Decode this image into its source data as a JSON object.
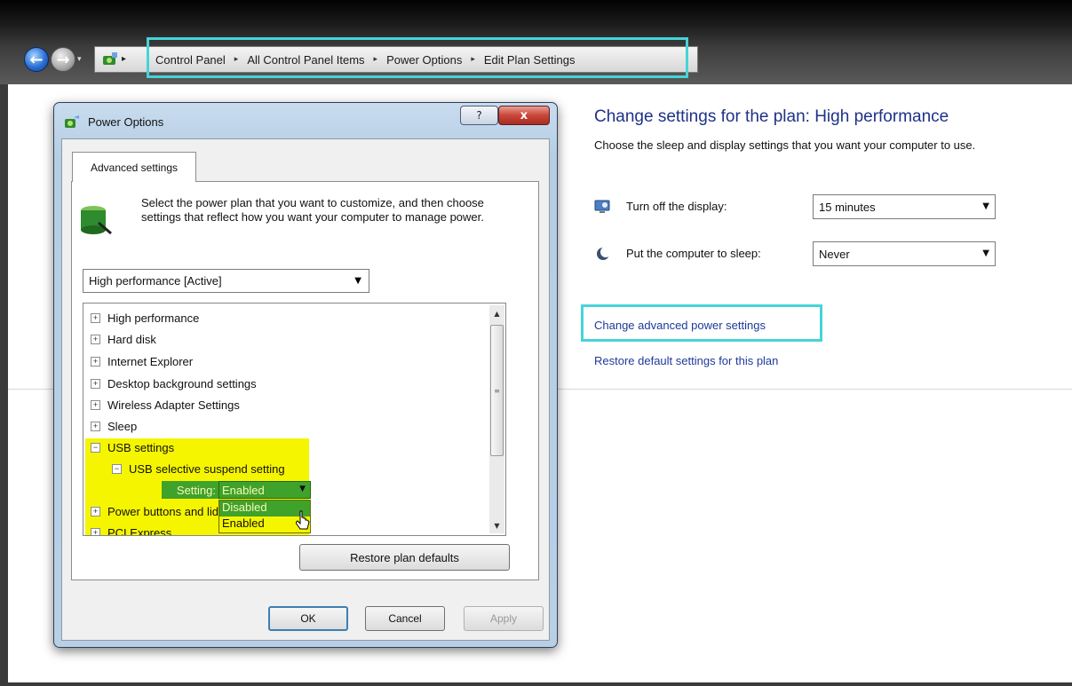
{
  "explorer": {
    "breadcrumbs": [
      "Control Panel",
      "All Control Panel Items",
      "Power Options",
      "Edit Plan Settings"
    ]
  },
  "plan": {
    "title": "Change settings for the plan: High performance",
    "subtitle": "Choose the sleep and display settings that you want your computer to use.",
    "display_label": "Turn off the display:",
    "display_value": "15 minutes",
    "sleep_label": "Put the computer to sleep:",
    "sleep_value": "Never",
    "advanced_link": "Change advanced power settings",
    "restore_link": "Restore default settings for this plan"
  },
  "dialog": {
    "title": "Power Options",
    "help_label": "?",
    "close_label": "x",
    "tab": "Advanced settings",
    "description": "Select the power plan that you want to customize, and then choose settings that reflect how you want your computer to manage power.",
    "plan_select": "High performance [Active]",
    "tree": {
      "items": [
        {
          "label": "High performance",
          "expander": "+"
        },
        {
          "label": "Hard disk",
          "expander": "+"
        },
        {
          "label": "Internet Explorer",
          "expander": "+"
        },
        {
          "label": "Desktop background settings",
          "expander": "+"
        },
        {
          "label": "Wireless Adapter Settings",
          "expander": "+"
        },
        {
          "label": "Sleep",
          "expander": "+"
        },
        {
          "label": "USB settings",
          "expander": "−"
        },
        {
          "label": "USB selective suspend setting",
          "expander": "−"
        },
        {
          "label": "Power buttons and lids",
          "expander": "+"
        },
        {
          "label": "PCI Express",
          "expander": "+"
        }
      ],
      "setting_label": "Setting:",
      "setting_value": "Enabled",
      "options": [
        "Disabled",
        "Enabled"
      ]
    },
    "restore_button": "Restore plan defaults",
    "ok": "OK",
    "cancel": "Cancel",
    "apply": "Apply"
  },
  "colors": {
    "highlight_outline": "#45d4d8",
    "usb_highlight": "#f5f500",
    "setting_green": "#3fa22a",
    "link_blue": "#1e3a9a"
  }
}
